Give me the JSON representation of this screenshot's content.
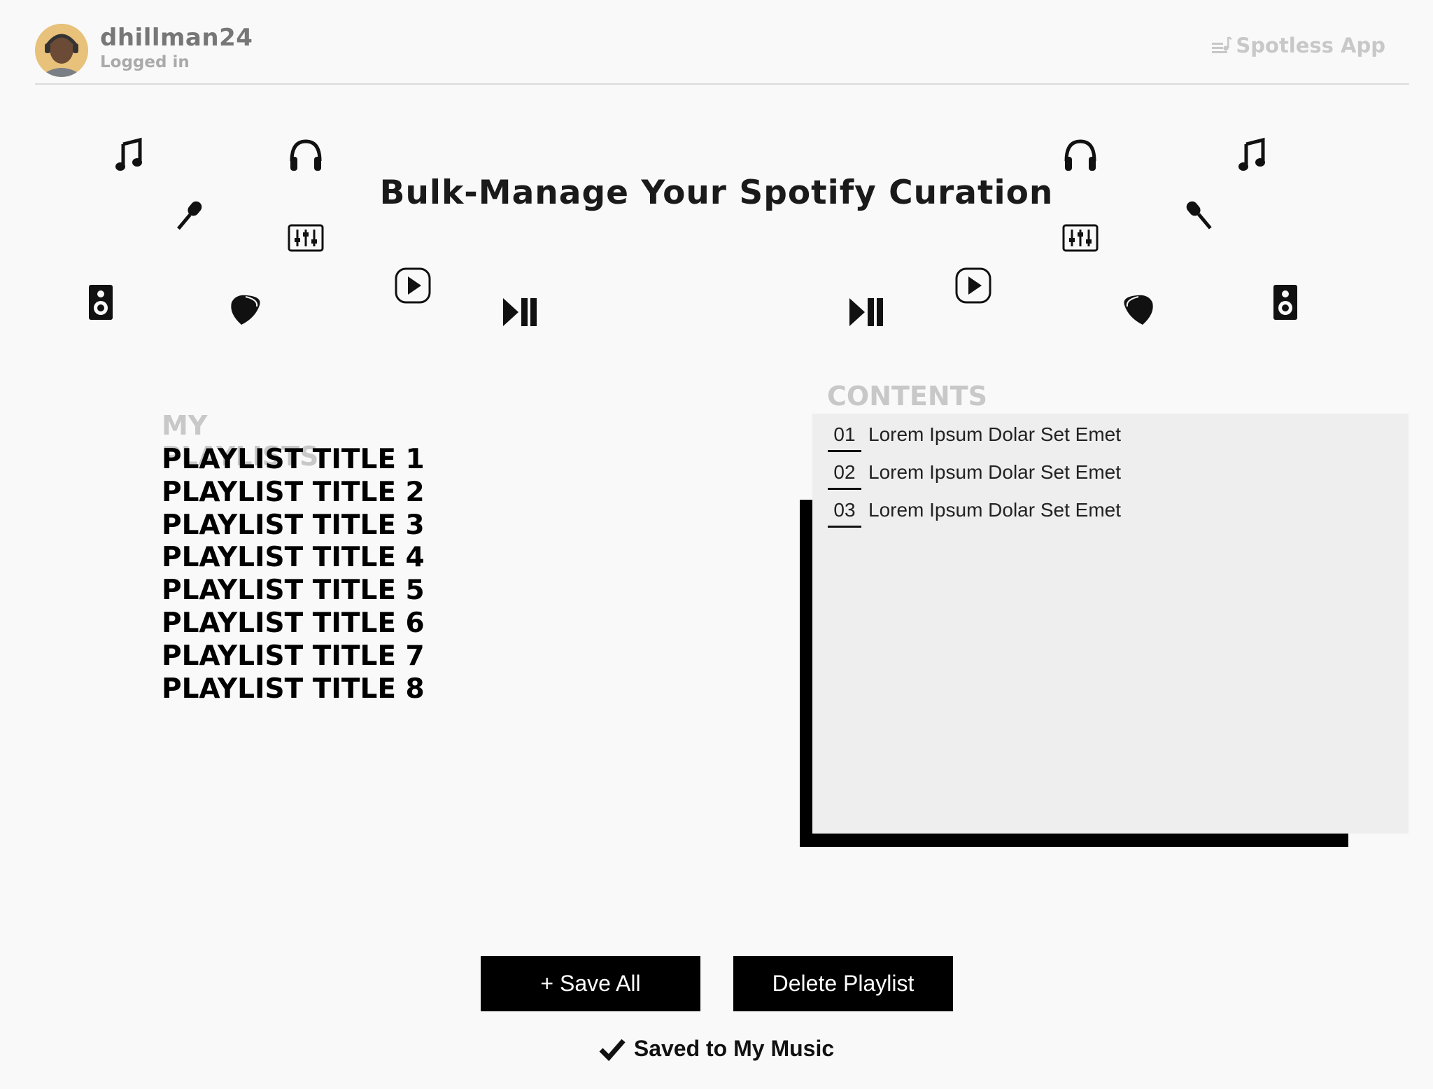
{
  "user": {
    "name": "dhillman24",
    "status": "Logged in"
  },
  "brand": {
    "name": "Spotless App",
    "icon": "playlist-music-icon"
  },
  "hero": {
    "title": "Bulk-Manage Your Spotify Curation"
  },
  "playlists": {
    "heading": "MY PLAYLISTS",
    "items": [
      "PLAYLIST TITLE 1",
      "PLAYLIST TITLE 2",
      "PLAYLIST TITLE 3",
      "PLAYLIST TITLE 4",
      "PLAYLIST TITLE 5",
      "PLAYLIST TITLE 6",
      "PLAYLIST TITLE 7",
      "PLAYLIST TITLE 8"
    ]
  },
  "contents": {
    "heading": "CONTENTS",
    "tracks": [
      {
        "num": "01",
        "title": "Lorem Ipsum Dolar Set Emet"
      },
      {
        "num": "02",
        "title": "Lorem Ipsum Dolar Set Emet"
      },
      {
        "num": "03",
        "title": "Lorem Ipsum Dolar Set Emet"
      }
    ]
  },
  "actions": {
    "save_all": "+ Save All",
    "delete": "Delete Playlist"
  },
  "status_message": "Saved to My Music",
  "colors": {
    "background": "#f9f9f9",
    "panel": "#eeeeee",
    "button": "#000000",
    "muted_label": "#c8c8c8"
  }
}
